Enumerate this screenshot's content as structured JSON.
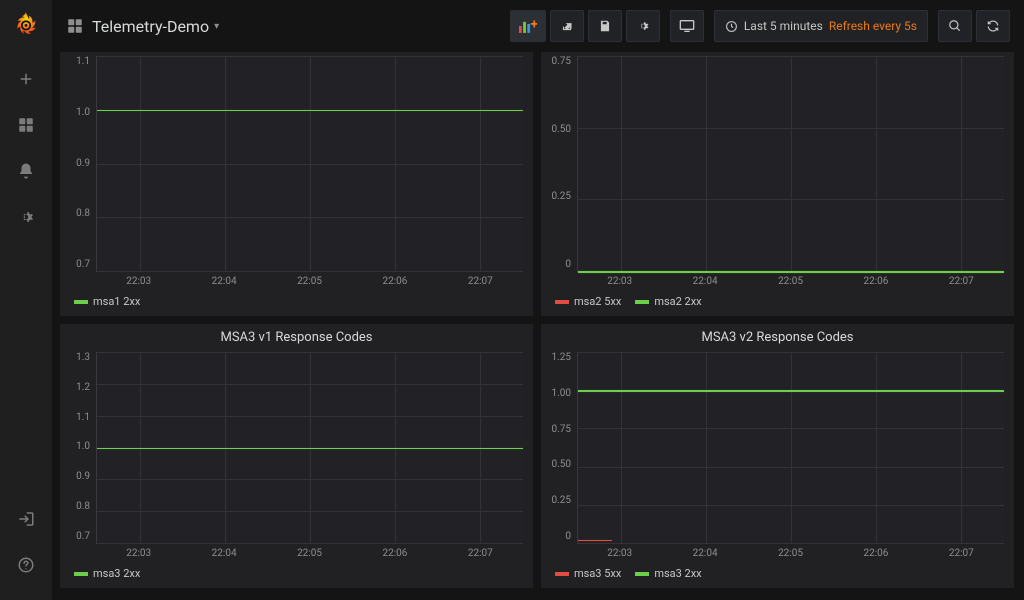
{
  "header": {
    "title": "Telemetry-Demo",
    "time_range": "Last 5 minutes",
    "refresh_label": "Refresh every 5s"
  },
  "panels": [
    {
      "title": "",
      "y_ticks": [
        "1.1",
        "1.0",
        "0.9",
        "0.8",
        "0.7"
      ],
      "x_ticks": [
        "22:03",
        "22:04",
        "22:05",
        "22:06",
        "22:07"
      ],
      "legend": [
        {
          "color": "green",
          "label": "msa1 2xx"
        }
      ]
    },
    {
      "title": "",
      "y_ticks": [
        "0.75",
        "0.50",
        "0.25",
        "0"
      ],
      "x_ticks": [
        "22:03",
        "22:04",
        "22:05",
        "22:06",
        "22:07"
      ],
      "legend": [
        {
          "color": "red",
          "label": "msa2 5xx"
        },
        {
          "color": "green",
          "label": "msa2 2xx"
        }
      ]
    },
    {
      "title": "MSA3 v1 Response Codes",
      "y_ticks": [
        "1.3",
        "1.2",
        "1.1",
        "1.0",
        "0.9",
        "0.8",
        "0.7"
      ],
      "x_ticks": [
        "22:03",
        "22:04",
        "22:05",
        "22:06",
        "22:07"
      ],
      "legend": [
        {
          "color": "green",
          "label": "msa3 2xx"
        }
      ]
    },
    {
      "title": "MSA3 v2 Response Codes",
      "y_ticks": [
        "1.25",
        "1.00",
        "0.75",
        "0.50",
        "0.25",
        "0"
      ],
      "x_ticks": [
        "22:03",
        "22:04",
        "22:05",
        "22:06",
        "22:07"
      ],
      "legend": [
        {
          "color": "red",
          "label": "msa3 5xx"
        },
        {
          "color": "green",
          "label": "msa3 2xx"
        }
      ]
    }
  ],
  "chart_data": [
    {
      "type": "line",
      "title": "",
      "xlabel": "",
      "ylabel": "",
      "ylim": [
        0.7,
        1.1
      ],
      "categories": [
        "22:03",
        "22:04",
        "22:05",
        "22:06",
        "22:07"
      ],
      "series": [
        {
          "name": "msa1 2xx",
          "color": "#6ccf4a",
          "values": [
            1.0,
            1.0,
            1.0,
            1.0,
            1.0
          ]
        }
      ]
    },
    {
      "type": "line",
      "title": "",
      "xlabel": "",
      "ylabel": "",
      "ylim": [
        0,
        0.9
      ],
      "categories": [
        "22:03",
        "22:04",
        "22:05",
        "22:06",
        "22:07"
      ],
      "series": [
        {
          "name": "msa2 5xx",
          "color": "#e24d42",
          "values": [
            0.0,
            0.0,
            0.0,
            0.0,
            0.0
          ]
        },
        {
          "name": "msa2 2xx",
          "color": "#6ccf4a",
          "values": [
            0.0,
            0.0,
            0.0,
            0.0,
            0.0
          ]
        }
      ]
    },
    {
      "type": "line",
      "title": "MSA3 v1 Response Codes",
      "xlabel": "",
      "ylabel": "",
      "ylim": [
        0.7,
        1.3
      ],
      "categories": [
        "22:03",
        "22:04",
        "22:05",
        "22:06",
        "22:07"
      ],
      "series": [
        {
          "name": "msa3 2xx",
          "color": "#6ccf4a",
          "values": [
            1.0,
            1.0,
            1.0,
            1.0,
            1.0
          ]
        }
      ]
    },
    {
      "type": "line",
      "title": "MSA3 v2 Response Codes",
      "xlabel": "",
      "ylabel": "",
      "ylim": [
        0,
        1.25
      ],
      "categories": [
        "22:03",
        "22:04",
        "22:05",
        "22:06",
        "22:07"
      ],
      "series": [
        {
          "name": "msa3 5xx",
          "color": "#e24d42",
          "values": [
            0.02,
            0.0,
            0.0,
            0.0,
            0.0
          ]
        },
        {
          "name": "msa3 2xx",
          "color": "#6ccf4a",
          "values": [
            1.0,
            1.0,
            1.0,
            1.0,
            1.0
          ]
        }
      ]
    }
  ]
}
